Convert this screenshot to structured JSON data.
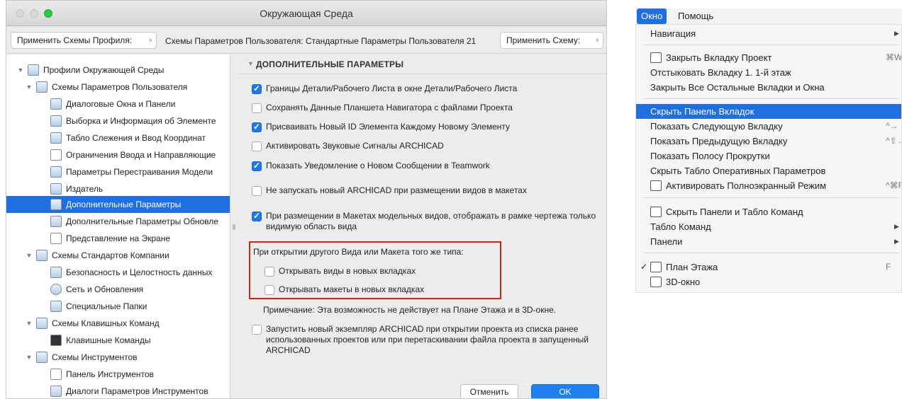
{
  "dialog": {
    "title": "Окружающая Среда",
    "toolbar": {
      "apply_profile_label": "Применить Схемы Профиля:",
      "user_schemes_text": "Схемы Параметров Пользователя: Стандартные Параметры Пользователя 21",
      "apply_scheme_label": "Применить Схему:",
      "arrow_glyph": "›"
    },
    "tree": [
      {
        "label": "Профили Окружающей Среды",
        "level": 0,
        "expanded": true,
        "icon": "profile-icon"
      },
      {
        "label": "Схемы Параметров Пользователя",
        "level": 1,
        "expanded": true,
        "icon": "user-schemes-icon"
      },
      {
        "label": "Диалоговые Окна и Панели",
        "level": 2,
        "icon": "dialogs-icon"
      },
      {
        "label": "Выборка и Информация об Элементе",
        "level": 2,
        "icon": "selection-icon"
      },
      {
        "label": "Табло Слежения и Ввод Координат",
        "level": 2,
        "icon": "tracker-icon"
      },
      {
        "label": "Ограничения Ввода и Направляющие",
        "level": 2,
        "icon": "constraints-icon"
      },
      {
        "label": "Параметры Перестраивания Модели",
        "level": 2,
        "icon": "rebuild-icon"
      },
      {
        "label": "Издатель",
        "level": 2,
        "icon": "publisher-icon"
      },
      {
        "label": "Дополнительные Параметры",
        "level": 2,
        "icon": "more-icon",
        "selected": true
      },
      {
        "label": "Дополнительные Параметры Обновле",
        "level": 2,
        "icon": "update-icon"
      },
      {
        "label": "Представление на Экране",
        "level": 2,
        "icon": "display-icon"
      },
      {
        "label": "Схемы Стандартов Компании",
        "level": 1,
        "expanded": true,
        "icon": "company-icon"
      },
      {
        "label": "Безопасность и Целостность данных",
        "level": 2,
        "icon": "safety-icon"
      },
      {
        "label": "Сеть и Обновления",
        "level": 2,
        "icon": "network-icon"
      },
      {
        "label": "Специальные Папки",
        "level": 2,
        "icon": "folders-icon"
      },
      {
        "label": "Схемы Клавишных Команд",
        "level": 1,
        "expanded": true,
        "icon": "shortcut-schemes-icon"
      },
      {
        "label": "Клавишные Команды",
        "level": 2,
        "icon": "shortcuts-icon"
      },
      {
        "label": "Схемы Инструментов",
        "level": 1,
        "expanded": true,
        "icon": "tool-schemes-icon"
      },
      {
        "label": "Панель Инструментов",
        "level": 2,
        "icon": "toolbar-icon"
      },
      {
        "label": "Диалоги Параметров Инструментов",
        "level": 2,
        "icon": "tool-dialogs-icon"
      }
    ],
    "section_title": "ДОПОЛНИТЕЛЬНЫЕ ПАРАМЕТРЫ",
    "options": [
      {
        "checked": true,
        "label": "Границы Детали/Рабочего Листа в окне Детали/Рабочего Листа"
      },
      {
        "checked": false,
        "label": "Сохранять Данные Планшета Навигатора с файлами Проекта"
      },
      {
        "checked": true,
        "label": "Присваивать Новый ID Элемента Каждому Новому Элементу"
      },
      {
        "checked": false,
        "label": "Активировать Звуковые Сигналы ARCHICAD"
      },
      {
        "checked": true,
        "label": "Показать Уведомление о Новом Сообщении в Teamwork"
      },
      {
        "checked": false,
        "label": "Не запускать новый  ARCHICAD при размещении видов в макетах"
      },
      {
        "checked": true,
        "label": "При размещении в Макетах модельных видов, отображать в рамке чертежа только видимую область вида"
      }
    ],
    "group": {
      "title": "При открытии другого Вида или Макета того же типа:",
      "items": [
        {
          "checked": false,
          "label": "Открывать виды в новых вкладках"
        },
        {
          "checked": false,
          "label": "Открывать макеты в новых вкладках"
        }
      ]
    },
    "note": "Примечание: Эта возможность не действует на Плане Этажа и в 3D-окне.",
    "last_option": {
      "checked": false,
      "label": "Запустить новый экземпляр ARCHICAD при открытии проекта из списка ранее использованных проектов или при перетаскивании файла проекта в запущенный ARCHICAD"
    },
    "cancel_label": "Отменить",
    "ok_label": "OK"
  },
  "menu": {
    "bar": [
      {
        "label": "Окно",
        "active": true
      },
      {
        "label": "Помощь",
        "active": false
      }
    ],
    "items": [
      {
        "label": "Навигация",
        "submenu": true
      },
      {
        "sep": true
      },
      {
        "label": "Закрыть Вкладку Проект",
        "shortcut": "⌘W",
        "icon": "close-tab-icon"
      },
      {
        "label": "Отстыковать Вкладку 1. 1-й этаж"
      },
      {
        "label": "Закрыть Все Остальные Вкладки и Окна"
      },
      {
        "sep": true
      },
      {
        "label": "Скрыть Панель Вкладок",
        "highlighted": true
      },
      {
        "label": "Показать Следующую Вкладку",
        "shortcut": "^→"
      },
      {
        "label": "Показать Предыдущую Вкладку",
        "shortcut": "^⇧→"
      },
      {
        "label": "Показать Полосу Прокрутки"
      },
      {
        "label": "Скрыть Табло Оперативных Параметров"
      },
      {
        "label": "Активировать Полноэкранный Режим",
        "shortcut": "^⌘F",
        "icon": "fullscreen-icon"
      },
      {
        "sep": true
      },
      {
        "label": "Скрыть Панели и Табло Команд",
        "icon": "hide-panels-icon"
      },
      {
        "label": "Табло Команд",
        "submenu": true
      },
      {
        "label": "Панели",
        "submenu": true
      },
      {
        "sep": true
      },
      {
        "label": "План Этажа",
        "checked": true,
        "shortcut": "F",
        "icon": "floor-plan-icon"
      },
      {
        "label": "3D-окно",
        "icon": "3d-window-icon"
      }
    ]
  },
  "colors": {
    "accent": "#1f6fe0",
    "highlight_box": "#c9231e",
    "ok_button": "#1e7fef"
  }
}
